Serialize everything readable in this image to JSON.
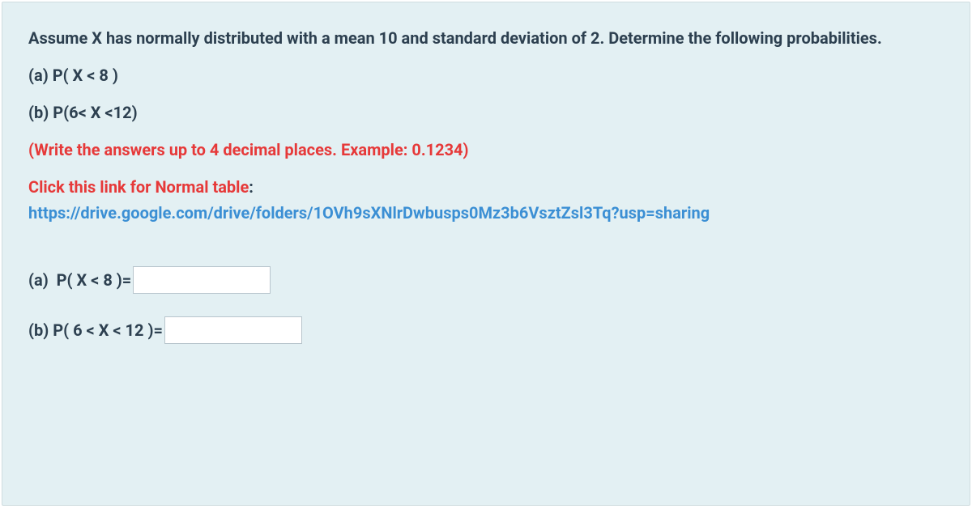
{
  "question": {
    "prompt": "Assume X has normally distributed with a mean 10 and standard deviation of 2. Determine the following probabilities.",
    "part_a": "(a) P( X < 8 )",
    "part_b": "(b) P(6< X <12)",
    "instruction": "(Write the answers up to 4 decimal places. Example: 0.1234)",
    "link_label": "Click this link for Normal table",
    "link_colon": ":",
    "link_url": "https://drive.google.com/drive/folders/1OVh9sXNlrDwbusps0Mz3b6VsztZsl3Tq?usp=sharing"
  },
  "answers": {
    "a_label": "(a)  P( X < 8 )=",
    "a_value": "",
    "b_label": "(b) P( 6 < X < 12 )=",
    "b_value": ""
  }
}
